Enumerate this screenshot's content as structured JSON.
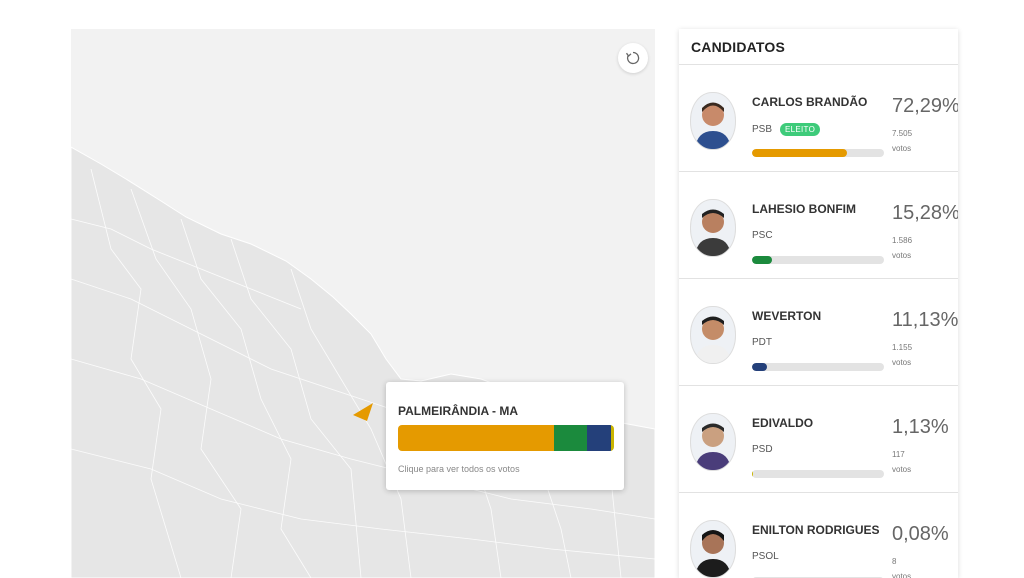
{
  "map": {
    "region_highlight_color": "#e59a00",
    "tooltip": {
      "title": "PALMEIRÂNDIA - MA",
      "hint": "Clique para ver todos os votos",
      "segments": [
        {
          "party": "PSB",
          "color": "#e59a00",
          "share": 0.7229
        },
        {
          "party": "PSC",
          "color": "#1b8a3d",
          "share": 0.1528
        },
        {
          "party": "PDT",
          "color": "#24407a",
          "share": 0.1113
        },
        {
          "party": "PSD",
          "color": "#c9b400",
          "share": 0.0113
        }
      ]
    }
  },
  "panel": {
    "title": "CANDIDATOS",
    "votes_label": "votos",
    "candidates": [
      {
        "name": "CARLOS BRANDÃO",
        "party": "PSB",
        "badge": "ELEITO",
        "percent": "72,29%",
        "votes": "7.505",
        "share": 0.7229,
        "color": "#e59a00"
      },
      {
        "name": "LAHESIO BONFIM",
        "party": "PSC",
        "badge": "",
        "percent": "15,28%",
        "votes": "1.586",
        "share": 0.1528,
        "color": "#1b8a3d"
      },
      {
        "name": "WEVERTON",
        "party": "PDT",
        "badge": "",
        "percent": "11,13%",
        "votes": "1.155",
        "share": 0.1113,
        "color": "#24407a"
      },
      {
        "name": "EDIVALDO",
        "party": "PSD",
        "badge": "",
        "percent": "1,13%",
        "votes": "117",
        "share": 0.0113,
        "color": "#c9b400"
      },
      {
        "name": "ENILTON RODRIGUES",
        "party": "PSOL",
        "badge": "",
        "percent": "0,08%",
        "votes": "8",
        "share": 0.0008,
        "color": "#c9b400"
      }
    ]
  }
}
